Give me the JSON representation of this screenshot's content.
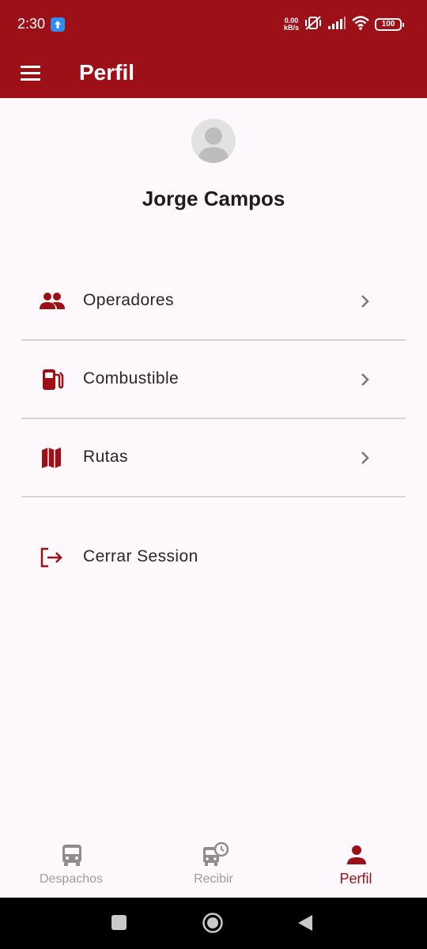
{
  "status_bar": {
    "time": "2:30",
    "net_speed_value": "0.00",
    "net_speed_unit": "kB/s",
    "battery": "100"
  },
  "app_bar": {
    "title": "Perfil",
    "menu_icon": "hamburger-menu-icon"
  },
  "profile": {
    "avatar_icon": "person-avatar-icon",
    "name": "Jorge Campos"
  },
  "menu": {
    "items": [
      {
        "label": "Operadores",
        "icon": "people-icon",
        "chevron": true
      },
      {
        "label": "Combustible",
        "icon": "gas-station-icon",
        "chevron": true
      },
      {
        "label": "Rutas",
        "icon": "map-icon",
        "chevron": true
      },
      {
        "label": "Cerrar Session",
        "icon": "logout-icon",
        "chevron": false
      }
    ]
  },
  "bottom_nav": {
    "items": [
      {
        "label": "Despachos",
        "icon": "bus-icon",
        "active": false
      },
      {
        "label": "Recibir",
        "icon": "bus-clock-icon",
        "active": false
      },
      {
        "label": "Perfil",
        "icon": "person-icon",
        "active": true
      }
    ]
  },
  "colors": {
    "primary": "#9e1018",
    "background": "#fdf8fb",
    "inactive": "#9e9a9e",
    "text": "#2a2629"
  }
}
